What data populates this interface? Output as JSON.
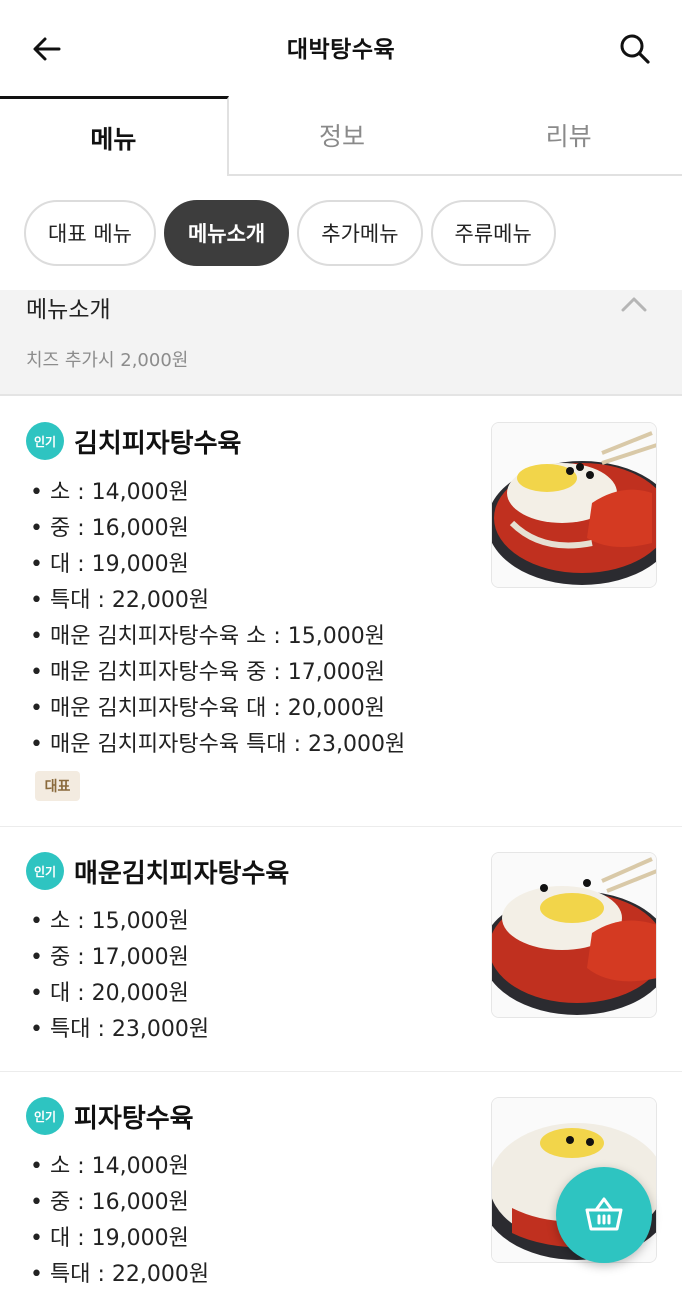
{
  "header": {
    "title": "대박탕수육",
    "back_icon": "arrow-left-icon",
    "search_icon": "search-icon"
  },
  "tabs": [
    {
      "label": "메뉴",
      "active": true
    },
    {
      "label": "정보",
      "active": false
    },
    {
      "label": "리뷰",
      "active": false
    }
  ],
  "chips": [
    {
      "label": "대표 메뉴",
      "active": false
    },
    {
      "label": "메뉴소개",
      "active": true
    },
    {
      "label": "추가메뉴",
      "active": false
    },
    {
      "label": "주류메뉴",
      "active": false
    }
  ],
  "section": {
    "title": "메뉴소개",
    "note": "치즈 추가시 2,000원",
    "collapse_icon": "chevron-up-icon"
  },
  "menu_items": [
    {
      "badge": "인기",
      "name": "김치피자탕수육",
      "prices": [
        "• 소 : 14,000원",
        "• 중 : 16,000원",
        "• 대 : 19,000원",
        "• 특대 : 22,000원",
        "• 매운 김치피자탕수육 소 : 15,000원",
        "• 매운 김치피자탕수육 중 : 17,000원",
        "• 매운 김치피자탕수육 대 : 20,000원",
        "• 매운 김치피자탕수육 특대 : 23,000원"
      ],
      "tag": "대표"
    },
    {
      "badge": "인기",
      "name": "매운김치피자탕수육",
      "prices": [
        "• 소 : 15,000원",
        "• 중 : 17,000원",
        "• 대 : 20,000원",
        "• 특대 : 23,000원"
      ]
    },
    {
      "badge": "인기",
      "name": "피자탕수육",
      "prices": [
        "• 소 : 14,000원",
        "• 중 : 16,000원",
        "• 대 : 19,000원",
        "• 특대 : 22,000원"
      ]
    }
  ],
  "cart": {
    "icon": "basket-icon"
  },
  "colors": {
    "accent": "#2ec4c1",
    "chip_active": "#3d3d3d",
    "tag_bg": "#f3ebe0",
    "tag_text": "#8a6a3c"
  }
}
